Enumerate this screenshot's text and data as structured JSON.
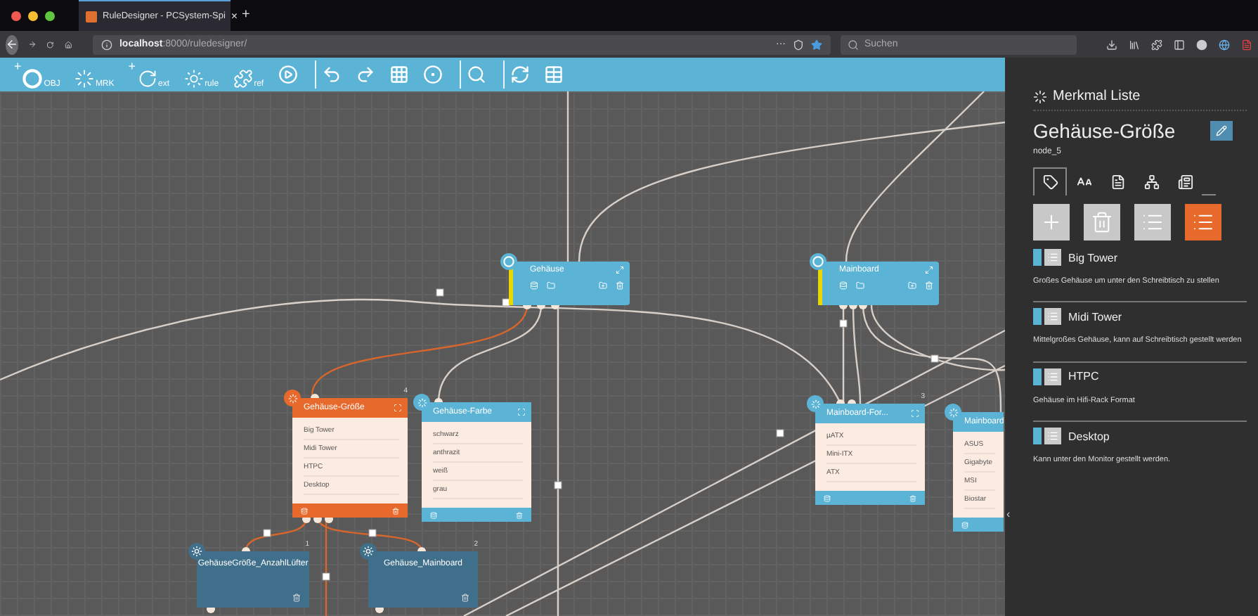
{
  "browser": {
    "tab_title": "RuleDesigner - PCSystem-Spi",
    "tab_close": "×",
    "new_tab": "+",
    "url": "**localhost**:8000/ruledesigner/",
    "page_menu": "···",
    "search": {
      "placeholder": "Suchen"
    }
  },
  "toolbar": {
    "groups": [
      {
        "tools": [
          {
            "kind": "labeled",
            "prefix": "+",
            "label": "OBJ"
          },
          {
            "kind": "labeled",
            "label": "MRK"
          },
          {
            "kind": "labeled",
            "prefix": "+",
            "label": "ext"
          },
          {
            "kind": "labeled",
            "label": "rule"
          },
          {
            "kind": "labeled",
            "label": "ref"
          },
          {
            "kind": "icon"
          }
        ]
      },
      {
        "tools": [
          {
            "kind": "icon"
          },
          {
            "kind": "icon"
          },
          {
            "kind": "icon"
          },
          {
            "kind": "icon"
          }
        ]
      },
      {
        "tools": [
          {
            "kind": "icon"
          }
        ]
      },
      {
        "tools": [
          {
            "kind": "icon"
          },
          {
            "kind": "icon"
          }
        ]
      }
    ]
  },
  "canvas": {
    "nodes": [
      {
        "kind": "class",
        "title": "Gehäuse"
      },
      {
        "kind": "class",
        "title": "Mainboard"
      },
      {
        "kind": "feature",
        "title": "Gehäuse-Größe",
        "number": "4",
        "selected": true,
        "values": [
          "Big Tower",
          "Midi Tower",
          "HTPC",
          "Desktop"
        ]
      },
      {
        "kind": "feature",
        "title": "Gehäuse-Farbe",
        "selected": false,
        "values": [
          "schwarz",
          "anthrazit",
          "weiß",
          "grau"
        ]
      },
      {
        "kind": "feature",
        "title": "Mainboard-For...",
        "number": "3",
        "selected": false,
        "values": [
          "µATX",
          "Mini-ITX",
          "ATX"
        ]
      },
      {
        "kind": "feature",
        "title": "Mainboard",
        "selected": false,
        "values": [
          "ASUS",
          "Gigabyte",
          "MSI",
          "Biostar"
        ]
      },
      {
        "kind": "rule",
        "title": "GehäuseGröße_AnzahlLüfter",
        "number": "1"
      },
      {
        "kind": "rule",
        "title": "Gehäuse_Mainboard",
        "number": "2"
      }
    ]
  },
  "panel": {
    "title": "Merkmal Liste",
    "feature_name": "Gehäuse-Größe",
    "node_id": "node_5",
    "collapse_glyph": "‹",
    "tabs": [
      {
        "selected": true
      },
      {
        "selected": false
      },
      {
        "selected": false
      },
      {
        "selected": false
      },
      {
        "selected": false
      }
    ],
    "actions": [
      {
        "selected": false
      },
      {
        "selected": false
      },
      {
        "selected": false
      },
      {
        "selected": true
      }
    ],
    "values": [
      {
        "name": "Big Tower",
        "description": "Großes Gehäuse um unter den Schreibtisch zu stellen"
      },
      {
        "name": "Midi Tower",
        "description": "Mittelgroßes Gehäuse, kann auf Schreibtisch gestellt werden"
      },
      {
        "name": "HTPC",
        "description": "Gehäuse im Hifi-Rack Format"
      },
      {
        "name": "Desktop",
        "description": "Kann unter den Monitor gestellt werden."
      }
    ]
  }
}
